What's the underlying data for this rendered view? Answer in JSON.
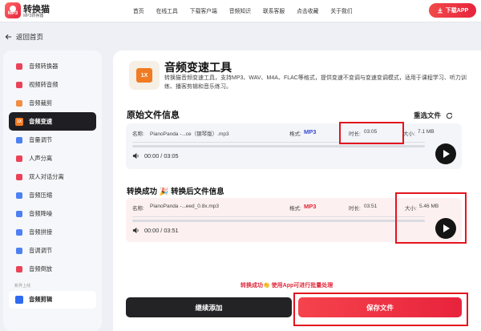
{
  "header": {
    "brand_name": "转换猫",
    "brand_sub": "MP3转换器",
    "logo_text": "MP3",
    "nav": [
      "首页",
      "在线工具",
      "下载客户端",
      "音频知识",
      "联系客服",
      "点击收藏",
      "关于我们"
    ],
    "download_label": "下载APP"
  },
  "back_label": "返回首页",
  "sidebar": {
    "items": [
      {
        "label": "音频转换器",
        "icon": "audio-convert-icon",
        "color": "#e8233c"
      },
      {
        "label": "视频转音频",
        "icon": "video-to-audio-icon",
        "color": "#e8233c"
      },
      {
        "label": "音频裁剪",
        "icon": "audio-cut-icon",
        "color": "#f07b22"
      },
      {
        "label": "音频变速",
        "icon": "audio-speed-icon",
        "color": "#f07b22"
      },
      {
        "label": "音量调节",
        "icon": "volume-icon",
        "color": "#2f6bf0"
      },
      {
        "label": "人声分离",
        "icon": "vocal-split-icon",
        "color": "#e8233c"
      },
      {
        "label": "双人对话分离",
        "icon": "dialog-split-icon",
        "color": "#e8233c"
      },
      {
        "label": "音频压缩",
        "icon": "audio-compress-icon",
        "color": "#2f6bf0"
      },
      {
        "label": "音频降噪",
        "icon": "denoise-icon",
        "color": "#2f6bf0"
      },
      {
        "label": "音频拼接",
        "icon": "audio-join-icon",
        "color": "#2f6bf0"
      },
      {
        "label": "音调调节",
        "icon": "pitch-icon",
        "color": "#2f6bf0"
      },
      {
        "label": "音频倒放",
        "icon": "reverse-icon",
        "color": "#e8233c"
      }
    ],
    "active_index": 3,
    "active_badge": "1X",
    "new_label": "新界上线",
    "new_item": "音频剪辑"
  },
  "tool": {
    "icon_text": "1X",
    "title": "音频变速工具",
    "desc": "转换猫音频变速工具，支持MP3、WAV、M4A、FLAC等格式，提供变速不变调与变速变调模式，适用于课程学习、听力训练、播客剪辑和音乐练习。"
  },
  "original": {
    "section_title": "原始文件信息",
    "reselect_label": "重选文件",
    "name_label": "名称:",
    "name": "PianoPanda -...ce（钢琴版）.mp3",
    "format_label": "格式:",
    "format": "MP3",
    "duration_label": "时长:",
    "duration": "03:05",
    "size_label": "大小:",
    "size": "7.1 MB",
    "time_display": "00:00 / 03:05"
  },
  "converted": {
    "section_title": "转换成功 🎉 转换后文件信息",
    "name_label": "名称:",
    "name": "PianoPanda -...eed_0.8x.mp3",
    "format_label": "格式:",
    "format": "MP3",
    "duration_label": "时长:",
    "duration": "03:51",
    "size_label": "大小:",
    "size": "5.46 MB",
    "time_display": "00:00 / 03:51"
  },
  "success_message": "转换成功👏 使用App可进行批量处理",
  "actions": {
    "continue_label": "继续添加",
    "save_label": "保存文件"
  },
  "colors": {
    "accent_red": "#e8233c",
    "format_blue": "#3a4ad0",
    "active_dark": "#1f1f23",
    "annotation_red": "#e3141f"
  }
}
